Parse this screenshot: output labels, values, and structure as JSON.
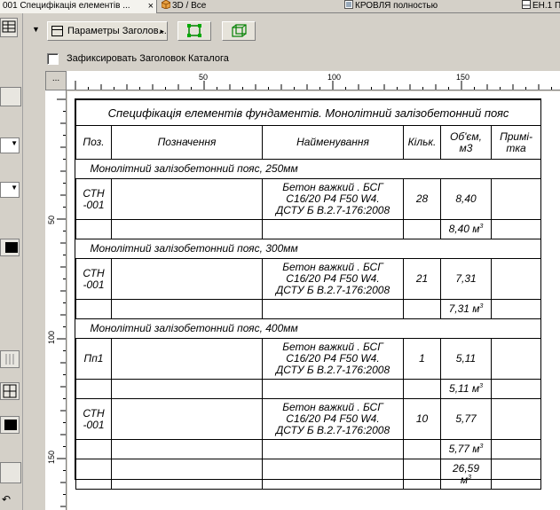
{
  "tabs": [
    {
      "label": "001 Специфікація елементів ...",
      "active": true
    },
    {
      "label": "3D / Все",
      "active": false
    },
    {
      "label": "КРОВЛЯ полностью",
      "active": false
    },
    {
      "label": "ЕН.1 П",
      "active": false
    }
  ],
  "toolbar": {
    "header_button_label": "Параметры Заголов...",
    "fix_checkbox_label": "Зафиксировать Заголовок Каталога",
    "fix_checked": false
  },
  "ruler": {
    "corner_label": "...",
    "h_labels": [
      "50",
      "100",
      "150"
    ],
    "v_labels": [
      "50",
      "100",
      "150"
    ]
  },
  "spec": {
    "title": "Специфікація елементів фундаментів. Монолітний залізобетонний пояс",
    "headers": {
      "pos": "Поз.",
      "designation": "Позначення",
      "name": "Найменування",
      "qty": "Кільк.",
      "volume_line1": "Об'єм,",
      "volume_line2": "м3",
      "note_line1": "Примі-",
      "note_line2": "тка"
    },
    "material_line1": "Бетон важкий . БСГ",
    "material_line2": "С16/20 Р4 F50 W4.",
    "material_line3": "ДСТУ Б В.2.7-176:2008",
    "groups": [
      {
        "title": "Монолітний залізобетонний пояс, 250мм",
        "rows": [
          {
            "pos_line1": "СТН",
            "pos_line2": "-001",
            "qty": "28",
            "volume": "8,40"
          }
        ],
        "subtotal": "8,40 м"
      },
      {
        "title": "Монолітний залізобетонний пояс, 300мм",
        "rows": [
          {
            "pos_line1": "СТН",
            "pos_line2": "-001",
            "qty": "21",
            "volume": "7,31"
          }
        ],
        "subtotal": "7,31 м"
      },
      {
        "title": "Монолітний залізобетонний пояс, 400мм",
        "rows": [
          {
            "pos_line1": "Пп1",
            "pos_line2": "",
            "qty": "1",
            "volume": "5,11"
          }
        ],
        "subtotal": "5,11 м",
        "rows2": [
          {
            "pos_line1": "СТН",
            "pos_line2": "-001",
            "qty": "10",
            "volume": "5,77"
          }
        ],
        "subtotal2": "5,77 м"
      }
    ],
    "total_line1": "26,59",
    "total_line2": "м",
    "unit_power": "3"
  }
}
